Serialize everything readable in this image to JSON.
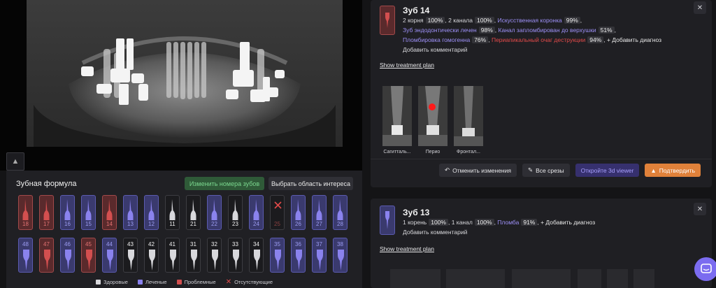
{
  "pano": {
    "collapse_icon": "chevron-up-icon"
  },
  "formula": {
    "title": "Зубная формула",
    "renumber_label": "Изменить номера зубов",
    "roi_label": "Выбрать область интереса",
    "upper": [
      {
        "n": "18",
        "s": "problem"
      },
      {
        "n": "17",
        "s": "problem"
      },
      {
        "n": "16",
        "s": "treated"
      },
      {
        "n": "15",
        "s": "treated"
      },
      {
        "n": "14",
        "s": "problem"
      },
      {
        "n": "13",
        "s": "treated"
      },
      {
        "n": "12",
        "s": "treated"
      },
      {
        "n": "11",
        "s": "healthy"
      },
      {
        "n": "21",
        "s": "healthy"
      },
      {
        "n": "22",
        "s": "treated"
      },
      {
        "n": "23",
        "s": "healthy"
      },
      {
        "n": "24",
        "s": "treated"
      },
      {
        "n": "25",
        "s": "missing"
      },
      {
        "n": "26",
        "s": "treated"
      },
      {
        "n": "27",
        "s": "treated"
      },
      {
        "n": "28",
        "s": "treated"
      }
    ],
    "lower": [
      {
        "n": "48",
        "s": "treated"
      },
      {
        "n": "47",
        "s": "problem"
      },
      {
        "n": "46",
        "s": "treated"
      },
      {
        "n": "45",
        "s": "problem"
      },
      {
        "n": "44",
        "s": "treated"
      },
      {
        "n": "43",
        "s": "healthy"
      },
      {
        "n": "42",
        "s": "healthy"
      },
      {
        "n": "41",
        "s": "healthy"
      },
      {
        "n": "31",
        "s": "healthy"
      },
      {
        "n": "32",
        "s": "healthy"
      },
      {
        "n": "33",
        "s": "healthy"
      },
      {
        "n": "34",
        "s": "healthy"
      },
      {
        "n": "35",
        "s": "treated"
      },
      {
        "n": "36",
        "s": "treated"
      },
      {
        "n": "37",
        "s": "treated"
      },
      {
        "n": "38",
        "s": "treated"
      }
    ],
    "legend": {
      "healthy": "Здоровые",
      "treated": "Леченые",
      "problem": "Проблемные",
      "missing": "Отсутствующие"
    },
    "colors": {
      "healthy": "#d8d8dc",
      "treated": "#8a82ee",
      "problem": "#d34f4f",
      "missing": "#e24a4a"
    }
  },
  "card1": {
    "title": "Зуб 14",
    "roots": "2 корня",
    "roots_pct": "100%",
    "canals": "2 канала",
    "canals_pct": "100%",
    "d1": "Искусственная коронка",
    "d1_pct": "99%",
    "d2": "Зуб эндодонтически лечен",
    "d2_pct": "98%",
    "d3": "Канал запломбирован до верхушки",
    "d3_pct": "51%",
    "d4": "Пломбировка гомогенна",
    "d4_pct": "76%",
    "d5": "Периапикальный очаг деструкции",
    "d5_pct": "94%",
    "add_diag": "+ Добавить диагноз",
    "add_comment": "Добавить комментарий",
    "show_plan": "Show treatment plan",
    "slices": [
      "Сагитталь...",
      "Перио",
      "Фронтал..."
    ],
    "revert": "Отменить изменения",
    "all_slices": "Все срезы",
    "open3d": "Откройте 3d viewer",
    "confirm": "Подтвердить",
    "close": "✕"
  },
  "card2": {
    "title": "Зуб 13",
    "roots": "1 корень",
    "roots_pct": "100%",
    "canals": "1 канал",
    "canals_pct": "100%",
    "d1": "Пломба",
    "d1_pct": "91%",
    "add_diag": "+ Добавить диагноз",
    "add_comment": "Добавить комментарий",
    "show_plan": "Show treatment plan",
    "close": "✕"
  }
}
